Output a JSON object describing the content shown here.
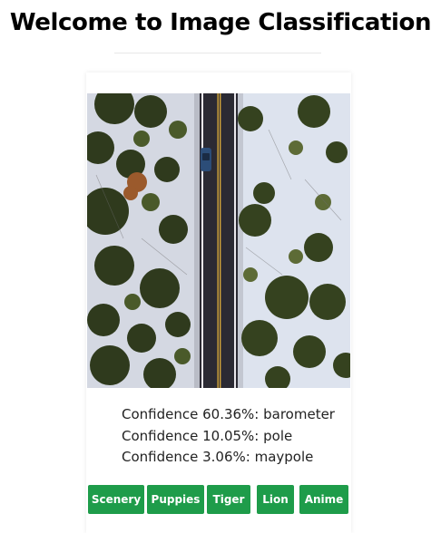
{
  "header": {
    "title": "Welcome to Image Classification"
  },
  "image": {
    "alt": "Aerial view of a road through snowy forest with a car"
  },
  "results": [
    {
      "text": "Confidence 60.36%: barometer"
    },
    {
      "text": "Confidence 10.05%: pole"
    },
    {
      "text": "Confidence 3.06%: maypole"
    }
  ],
  "buttons": [
    {
      "label": "Scenery"
    },
    {
      "label": "Puppies"
    },
    {
      "label": "Tiger"
    },
    {
      "label": "Lion"
    },
    {
      "label": "Anime"
    }
  ],
  "colors": {
    "button": "#1e9c4a",
    "button_text": "#ffffff"
  }
}
